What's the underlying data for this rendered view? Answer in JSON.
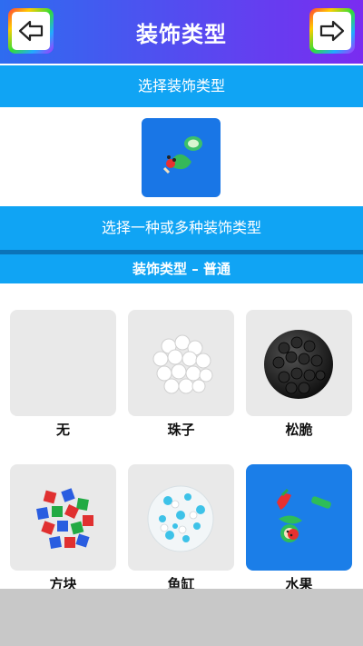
{
  "header": {
    "title": "装饰类型",
    "back_icon": "arrow-left-icon",
    "forward_icon": "arrow-right-icon"
  },
  "section_select": {
    "label": "选择装饰类型"
  },
  "section_multi": {
    "label": "选择一种或多种装饰类型"
  },
  "section_category": {
    "label": "装饰类型 – 普通"
  },
  "options": [
    {
      "label": "无",
      "icon": "none-icon",
      "selected": false
    },
    {
      "label": "珠子",
      "icon": "beads-icon",
      "selected": false
    },
    {
      "label": "松脆",
      "icon": "crunchy-ball-icon",
      "selected": false
    },
    {
      "label": "方块",
      "icon": "cubes-icon",
      "selected": false
    },
    {
      "label": "鱼缸",
      "icon": "fishbowl-icon",
      "selected": false
    },
    {
      "label": "水果",
      "icon": "fruit-icon",
      "selected": true
    }
  ],
  "colors": {
    "header_start": "#2e6cf0",
    "header_end": "#7a2cf0",
    "band": "#10a4f4",
    "selected": "#1b7ee8"
  }
}
